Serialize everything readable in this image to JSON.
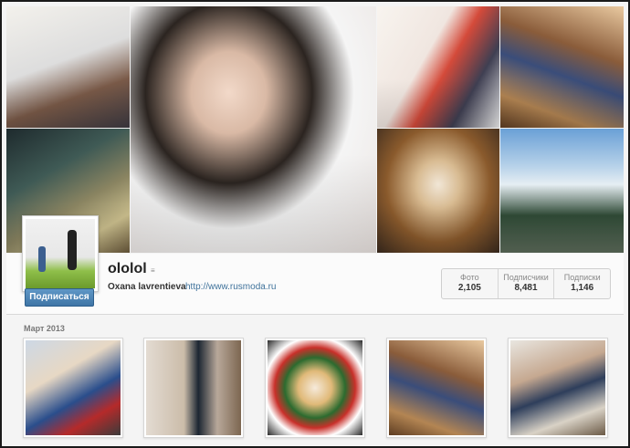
{
  "profile": {
    "username": "ololol",
    "full_name": "Oxana lavrentieva",
    "website": "http://www.rusmoda.ru",
    "subscribe_label": "Подписаться"
  },
  "stats": [
    {
      "label": "Фото",
      "value": "2,105"
    },
    {
      "label": "Подписчики",
      "value": "8,481"
    },
    {
      "label": "Подписки",
      "value": "1,146"
    }
  ],
  "feed": {
    "month_label": "Март 2013"
  },
  "icons": {
    "verified": "badge-icon"
  }
}
